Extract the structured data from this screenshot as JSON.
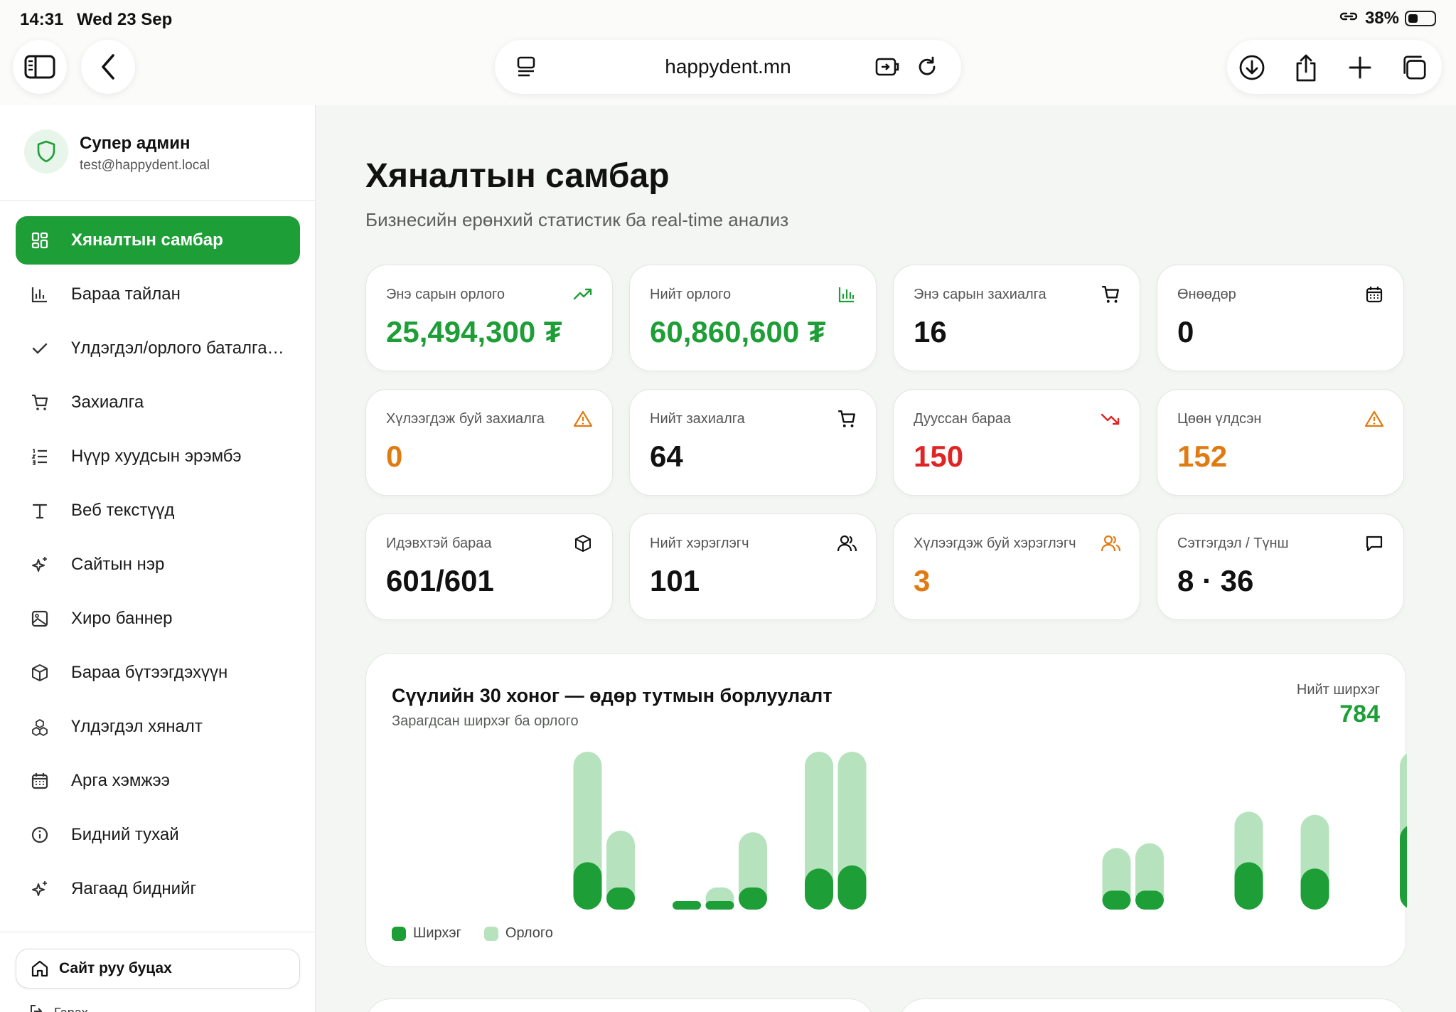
{
  "status_bar": {
    "time": "14:31",
    "date": "Wed 23 Sep",
    "battery": "38%"
  },
  "browser": {
    "url": "happydent.mn"
  },
  "profile": {
    "name": "Супер админ",
    "email": "test@happydent.local"
  },
  "sidebar": {
    "items": [
      {
        "label": "Хяналтын самбар",
        "icon": "grid-icon",
        "active": true
      },
      {
        "label": "Бараа тайлан",
        "icon": "bar-chart-icon"
      },
      {
        "label": "Үлдэгдэл/орлого баталгаажуулалт",
        "icon": "check-icon"
      },
      {
        "label": "Захиалга",
        "icon": "cart-icon"
      },
      {
        "label": "Нүүр хуудсын эрэмбэ",
        "icon": "list-ordered-icon"
      },
      {
        "label": "Веб текстүүд",
        "icon": "text-icon"
      },
      {
        "label": "Сайтын нэр",
        "icon": "sparkles-icon"
      },
      {
        "label": "Хиро баннер",
        "icon": "image-icon"
      },
      {
        "label": "Бараа бүтээгдэхүүн",
        "icon": "box-icon"
      },
      {
        "label": "Үлдэгдэл хяналт",
        "icon": "boxes-icon"
      },
      {
        "label": "Арга хэмжээ",
        "icon": "calendar-icon"
      },
      {
        "label": "Бидний тухай",
        "icon": "info-icon"
      },
      {
        "label": "Яагаад биднийг",
        "icon": "sparkles-icon"
      }
    ],
    "back_to_site": "Сайт руу буцах",
    "logout": "Гарах"
  },
  "header": {
    "title": "Хяналтын самбар",
    "subtitle": "Бизнесийн ерөнхий статистик ба real-time анализ"
  },
  "stats": [
    {
      "label": "Энэ сарын орлого",
      "value": "25,494,300 ₮",
      "icon": "trending-up-icon",
      "color": "#1e9e36"
    },
    {
      "label": "Нийт орлого",
      "value": "60,860,600 ₮",
      "icon": "bar-chart-icon",
      "color": "#1e9e36"
    },
    {
      "label": "Энэ сарын захиалга",
      "value": "16",
      "icon": "cart-icon",
      "color": "#111111"
    },
    {
      "label": "Өнөөдөр",
      "value": "0",
      "icon": "calendar-icon",
      "color": "#111111"
    },
    {
      "label": "Хүлээгдэж буй захиалга",
      "value": "0",
      "icon": "warning-icon",
      "color": "#e07b12"
    },
    {
      "label": "Нийт захиалга",
      "value": "64",
      "icon": "cart-icon",
      "color": "#111111"
    },
    {
      "label": "Дууссан бараа",
      "value": "150",
      "icon": "trending-down-icon",
      "color": "#e02424"
    },
    {
      "label": "Цөөн үлдсэн",
      "value": "152",
      "icon": "warning-icon",
      "color": "#e07b12"
    },
    {
      "label": "Идэвхтэй бараа",
      "value": "601/601",
      "icon": "box-icon",
      "color": "#111111"
    },
    {
      "label": "Нийт хэрэглэгч",
      "value": "101",
      "icon": "users-icon",
      "color": "#111111"
    },
    {
      "label": "Хүлээгдэж буй хэрэглэгч",
      "value": "3",
      "icon": "users-icon",
      "color": "#e07b12"
    },
    {
      "label": "Сэтгэгдэл / Түнш",
      "value": "8 · 36",
      "icon": "message-icon",
      "color": "#111111"
    }
  ],
  "chart": {
    "title": "Сүүлийн 30 хоног — өдөр тутмын борлуулалт",
    "subtitle": "Зарагдсан ширхэг ба орлого",
    "total_label": "Нийт ширхэг",
    "total_value": "784",
    "legend": [
      "Ширхэг",
      "Орлого"
    ]
  },
  "chart_data": {
    "type": "bar",
    "series": [
      {
        "name": "Ширхэг",
        "color": "#1e9e36",
        "values": [
          0,
          0,
          0,
          30,
          14,
          0,
          2,
          2,
          14,
          0,
          26,
          28,
          0,
          0,
          0,
          0,
          0,
          0,
          0,
          12,
          12,
          0,
          0,
          30,
          0,
          26,
          0,
          0,
          54,
          0
        ]
      },
      {
        "name": "Орлого",
        "color": "#b6e3bd",
        "values": [
          0,
          0,
          0,
          100,
          50,
          0,
          5,
          14,
          49,
          0,
          100,
          100,
          0,
          0,
          0,
          0,
          0,
          0,
          0,
          39,
          42,
          0,
          0,
          62,
          0,
          60,
          0,
          0,
          100,
          0
        ]
      }
    ],
    "x_count": 30,
    "ylim": [
      0,
      100
    ]
  }
}
